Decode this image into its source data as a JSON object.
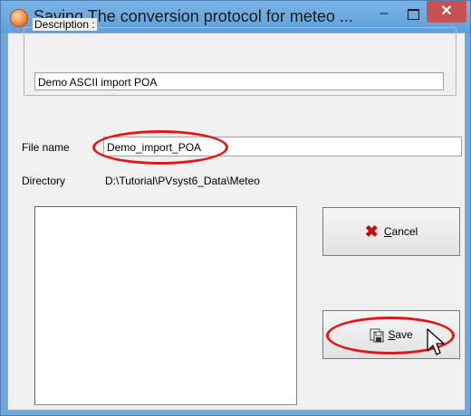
{
  "window": {
    "title": "Saving  The conversion protocol for meteo ...",
    "minimize_label": "–",
    "close_label": "✕"
  },
  "description": {
    "legend": "Description :",
    "value": "Demo ASCII import POA"
  },
  "file_name": {
    "label": "File name",
    "value": "Demo_import_POA"
  },
  "directory": {
    "label": "Directory",
    "value": "D:\\Tutorial\\PVsyst6_Data\\Meteo"
  },
  "buttons": {
    "cancel_accel": "C",
    "cancel_rest": "ancel",
    "save_accel": "S",
    "save_rest": "ave"
  },
  "colors": {
    "highlight_oval": "#e01818",
    "cancel_icon": "#c01010"
  }
}
